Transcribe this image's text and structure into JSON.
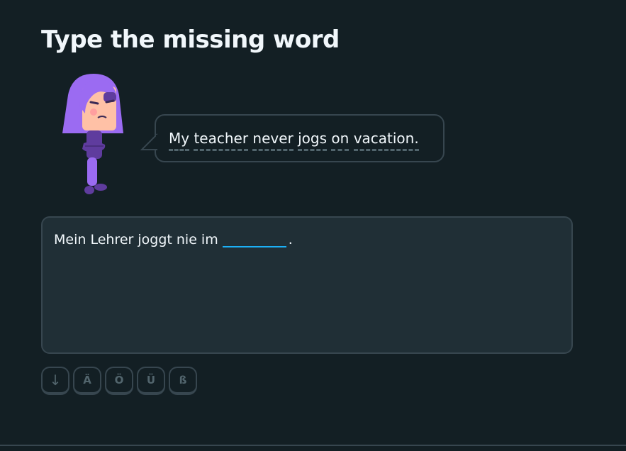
{
  "challenge": {
    "title": "Type the missing word"
  },
  "prompt": {
    "words": [
      "My",
      "teacher",
      "never",
      "jogs",
      "on",
      "vacation."
    ]
  },
  "answer": {
    "before_blank": "Mein Lehrer joggt nie im",
    "blank_value": "",
    "after_blank": "."
  },
  "special_keys": [
    "↓",
    "Ä",
    "Ö",
    "Ü",
    "ß"
  ],
  "icons": {
    "character": "character-lily-icon",
    "collapse": "arrow-down-icon"
  },
  "colors": {
    "background": "#131f24",
    "panel": "#202f36",
    "border": "#37464f",
    "accent": "#1cb0f6",
    "character": "#ce82ff"
  }
}
